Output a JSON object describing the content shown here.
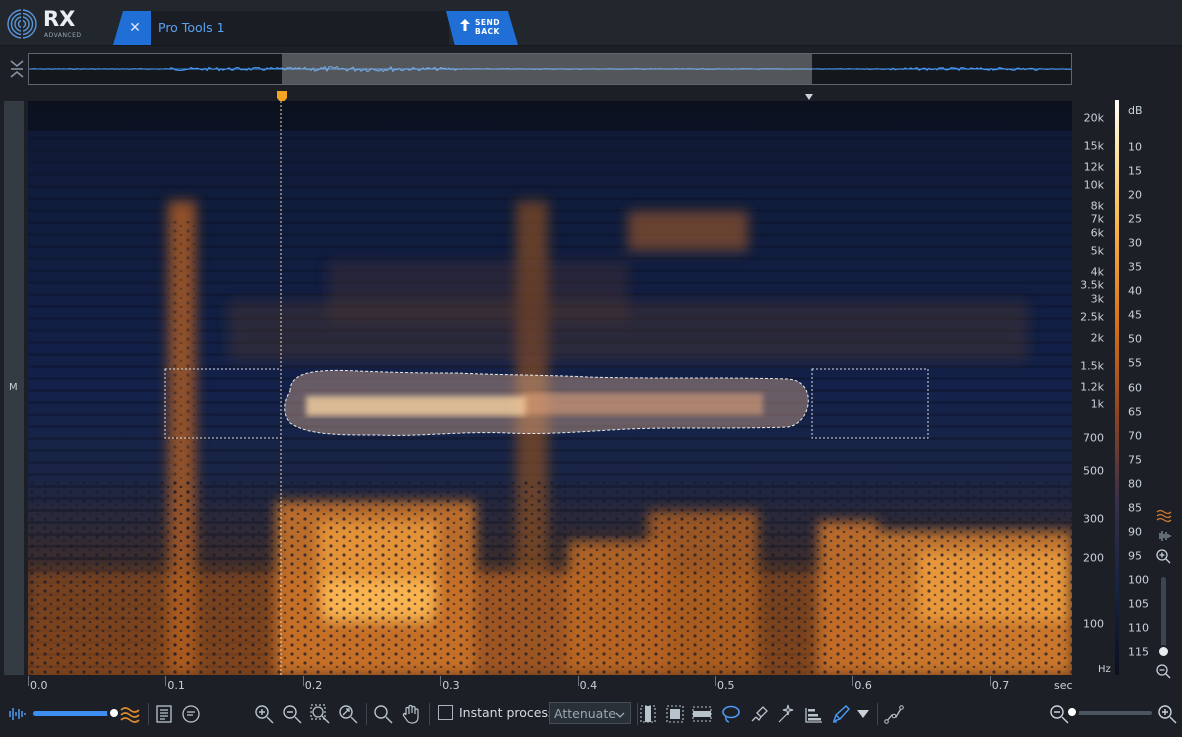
{
  "app": {
    "logo_text": "RX",
    "logo_sub": "ADVANCED",
    "tab_title": "Pro Tools 1",
    "send_back_label": "SEND\nBACK"
  },
  "channel": {
    "label": "M"
  },
  "frequency_axis": {
    "unit": "Hz",
    "labels": [
      "20k",
      "15k",
      "12k",
      "10k",
      "8k",
      "7k",
      "6k",
      "5k",
      "4k",
      "3.5k",
      "3k",
      "2.5k",
      "2k",
      "1.5k",
      "1.2k",
      "1k",
      "700",
      "500",
      "300",
      "200",
      "100"
    ]
  },
  "db_scale": {
    "unit": "dB",
    "labels": [
      "10",
      "15",
      "20",
      "25",
      "30",
      "35",
      "40",
      "45",
      "50",
      "55",
      "60",
      "65",
      "70",
      "75",
      "80",
      "85",
      "90",
      "95",
      "100",
      "105",
      "110",
      "115"
    ]
  },
  "time_axis": {
    "unit": "sec",
    "labels": [
      "0.0",
      "0.1",
      "0.2",
      "0.3",
      "0.4",
      "0.5",
      "0.6",
      "0.7"
    ]
  },
  "toolbar": {
    "instant_process_label": "Instant process",
    "instant_process_checked": false,
    "mode_value": "Attenuate",
    "opacity_level": 1.0,
    "horizontal_zoom_level": 0.05
  },
  "colors": {
    "accent": "#1f6fd6",
    "spectrogram_low": "#0f1a36",
    "spectrogram_high": "#f7a64a"
  },
  "icons": {
    "waveform_toggle": "waveform-icon",
    "spectrogram_toggle": "spectrogram-icon",
    "history": "history-icon",
    "comments": "comment-icon",
    "zoom_in": "zoom-in-icon",
    "zoom_out": "zoom-out-icon",
    "zoom_selection": "zoom-selection-icon",
    "zoom_fit": "zoom-fit-icon",
    "zoom_tool": "magnifier-icon",
    "hand_tool": "hand-icon",
    "time_select": "time-selection-icon",
    "time_freq_select": "time-frequency-selection-icon",
    "freq_select": "frequency-selection-icon",
    "lasso": "lasso-icon",
    "brush": "brush-icon",
    "magic_wand": "magic-wand-icon",
    "harmonic": "harmonic-selection-icon",
    "pen": "pen-icon",
    "curve": "curve-icon"
  }
}
